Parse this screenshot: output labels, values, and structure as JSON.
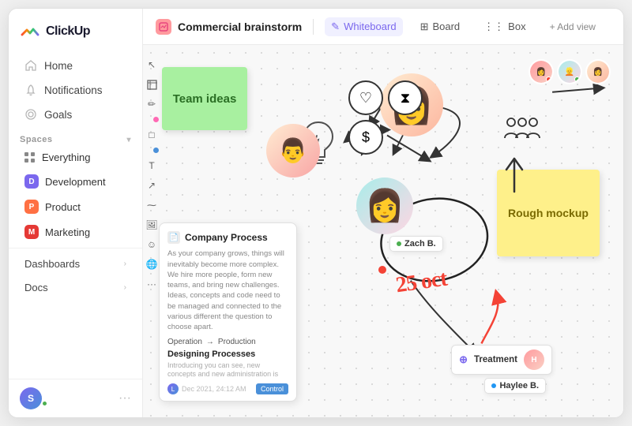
{
  "app": {
    "name": "ClickUp"
  },
  "sidebar": {
    "logo": "ClickUp",
    "nav": [
      {
        "id": "home",
        "label": "Home",
        "icon": "home"
      },
      {
        "id": "notifications",
        "label": "Notifications",
        "icon": "bell"
      },
      {
        "id": "goals",
        "label": "Goals",
        "icon": "target"
      }
    ],
    "spaces_label": "Spaces",
    "spaces": [
      {
        "id": "everything",
        "label": "Everything",
        "color": "none",
        "letter": ""
      },
      {
        "id": "development",
        "label": "Development",
        "color": "#7b68ee",
        "letter": "D"
      },
      {
        "id": "product",
        "label": "Product",
        "color": "#ff7043",
        "letter": "P"
      },
      {
        "id": "marketing",
        "label": "Marketing",
        "color": "#e53935",
        "letter": "M"
      }
    ],
    "bottom": [
      {
        "id": "dashboards",
        "label": "Dashboards"
      },
      {
        "id": "docs",
        "label": "Docs"
      }
    ],
    "user": {
      "initial": "S"
    }
  },
  "header": {
    "title": "Commercial brainstorm",
    "icon": "whiteboard-icon",
    "views": [
      {
        "id": "whiteboard",
        "label": "Whiteboard",
        "active": true,
        "icon": "✎"
      },
      {
        "id": "board",
        "label": "Board",
        "active": false,
        "icon": "⊞"
      },
      {
        "id": "box",
        "label": "Box",
        "active": false,
        "icon": "⋮⋮"
      }
    ],
    "add_view": "+ Add view"
  },
  "canvas": {
    "sticky_green": {
      "text": "Team ideas"
    },
    "sticky_yellow": {
      "text": "Rough mockup"
    },
    "doc_card": {
      "title": "Company Process",
      "body": "As your company grows, things will inevitably become more complex. We hire more people, form new teams, and bring ideas, concepts and code need to be managed and connected to the various different the question to choose apart.",
      "row1_left": "Operation",
      "row1_right": "Production",
      "section_title": "Designing Processes",
      "section_body": "Introducing you can see, new concepts and new administration is",
      "footer_date": "Dec 2021, 24:12 AM",
      "footer_btn": "Control"
    },
    "zach_label": "Zach B.",
    "handwriting": "25 oct",
    "treatment_label": "Treatment",
    "haylee_label": "Haylee B."
  }
}
